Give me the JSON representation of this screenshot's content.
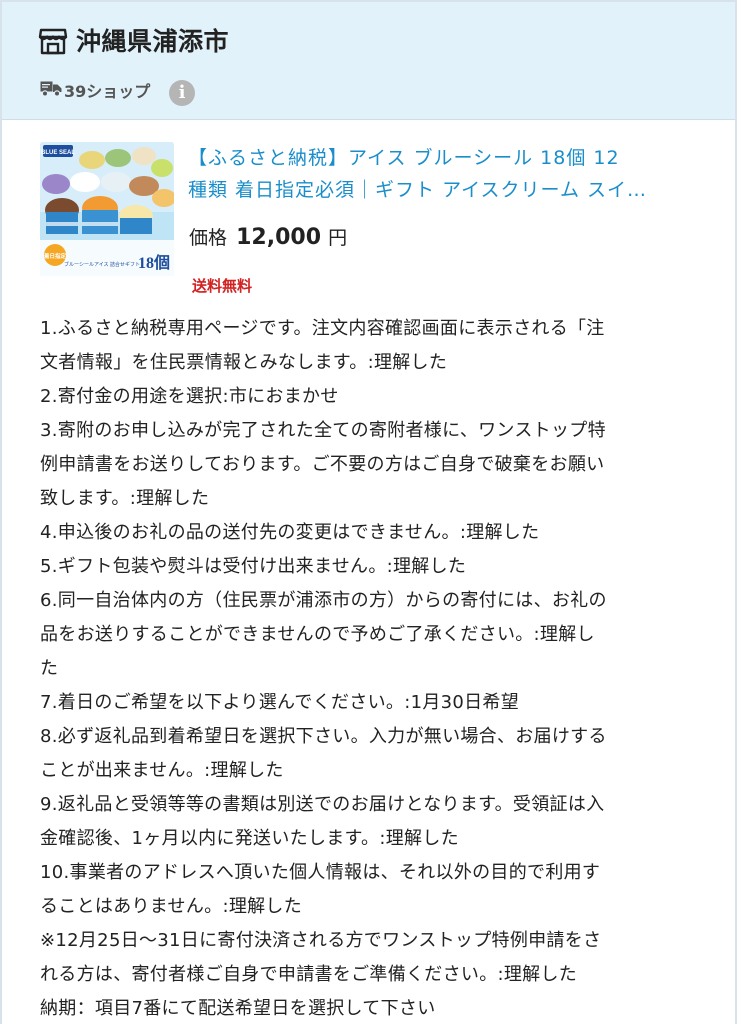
{
  "shop": {
    "name": "沖縄県浦添市",
    "shipping_label": "39ショップ",
    "info_glyph": "i"
  },
  "product": {
    "title_lines": [
      "【ふるさと納税】アイス ブルーシール 18個 12",
      "種類 着日指定必須｜ギフト アイスクリーム スイ…"
    ],
    "price_label": "価格",
    "price_value": "12,000",
    "price_unit": "円",
    "shipping_free": "送料無料",
    "thumbnail": {
      "brand_text": "BLUE SEAL",
      "count_text": "18個",
      "caption_text": "ブルーシールアイス 詰合せギフト",
      "badge_text": "着日指定"
    }
  },
  "notes": [
    "1.ふるさと納税専用ページです。注文内容確認画面に表示される「注",
    "文者情報」を住民票情報とみなします。:理解した",
    "2.寄付金の用途を選択:市におまかせ",
    "3.寄附のお申し込みが完了された全ての寄附者様に、ワンストップ特",
    "例申請書をお送りしております。ご不要の方はご自身で破棄をお願い",
    "致します。:理解した",
    "4.申込後のお礼の品の送付先の変更はできません。:理解した",
    "5.ギフト包装や熨斗は受付け出来ません。:理解した",
    "6.同一自治体内の方（住民票が浦添市の方）からの寄付には、お礼の",
    "品をお送りすることができませんので予めご了承ください。:理解し",
    "た",
    "7.着日のご希望を以下より選んでください。:1月30日希望",
    "8.必ず返礼品到着希望日を選択下さい。入力が無い場合、お届けする",
    "ことが出来ません。:理解した",
    "9.返礼品と受領等等の書類は別送でのお届けとなります。受領証は入",
    "金確認後、1ヶ月以内に発送いたします。:理解した",
    "10.事業者のアドレスへ頂いた個人情報は、それ以外の目的で利用す",
    "ることはありません。:理解した",
    "※12月25日〜31日に寄付決済される方でワンストップ特例申請をさ",
    "れる方は、寄付者様ご自身で申請書をご準備ください。:理解した",
    "納期：項目7番にて配送希望日を選択して下さい"
  ],
  "icons": {
    "store": "store-icon",
    "truck": "truck-icon",
    "info": "info-icon"
  },
  "colors": {
    "header_bg": "#e1f2fb",
    "link_blue": "#1a8ecb",
    "free_shipping_red": "#d22222",
    "info_gray": "#b5b5b5"
  }
}
